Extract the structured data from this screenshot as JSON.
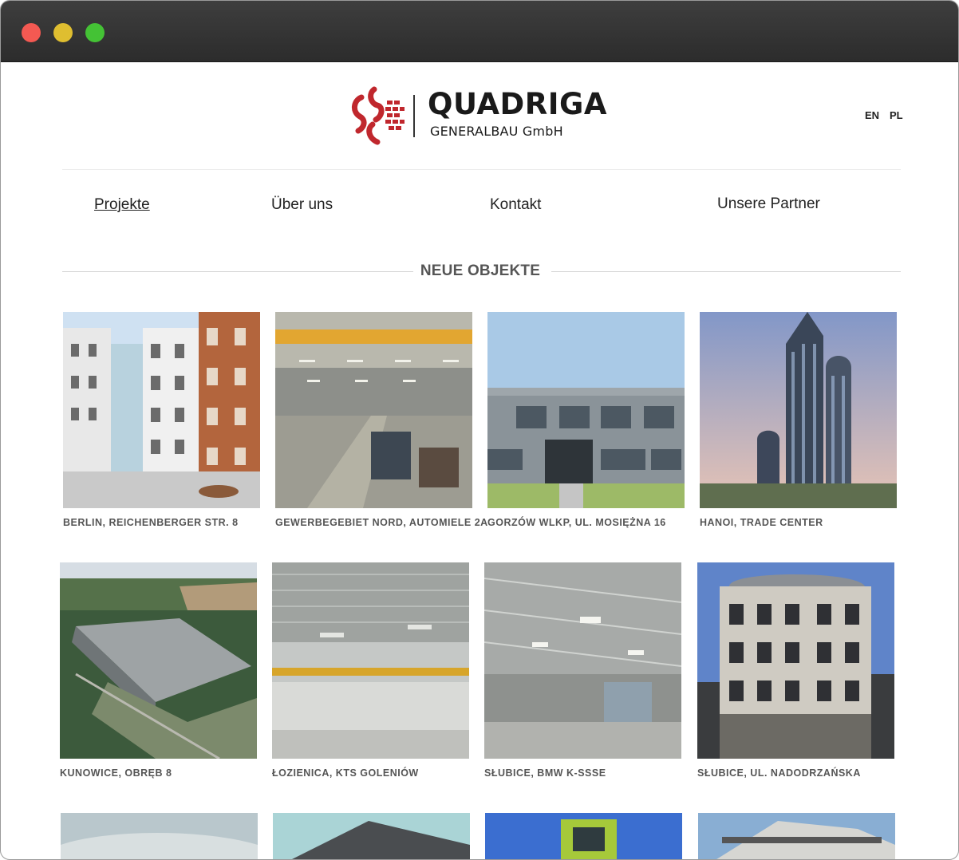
{
  "window": {
    "controls": [
      "close",
      "minimize",
      "maximize"
    ]
  },
  "header": {
    "logo": {
      "title": "QUADRIGA",
      "subtitle": "GENERALBAU GmbH",
      "accent_color": "#c0272d"
    },
    "languages": [
      "EN",
      "PL"
    ]
  },
  "nav": {
    "items": [
      {
        "label": "Projekte",
        "active": true
      },
      {
        "label": "Über uns",
        "active": false
      },
      {
        "label": "Kontakt",
        "active": false
      },
      {
        "label": "Unsere Partner",
        "active": false
      }
    ]
  },
  "section": {
    "title": "NEUE OBJEKTE"
  },
  "projects": [
    {
      "caption": "BERLIN, REICHENBERGER STR. 8"
    },
    {
      "caption": "GEWERBEGEBIET NORD, AUTOMIELE 2A"
    },
    {
      "caption": "GORZÓW WLKP, UL. MOSIĘŻNA 16"
    },
    {
      "caption": "HANOI, TRADE CENTER"
    },
    {
      "caption": "KUNOWICE, OBRĘB 8"
    },
    {
      "caption": "ŁOZIENICA, KTS GOLENIÓW"
    },
    {
      "caption": "SŁUBICE, BMW K-SSSE"
    },
    {
      "caption": "SŁUBICE, UL. NADODRZAŃSKA"
    }
  ]
}
